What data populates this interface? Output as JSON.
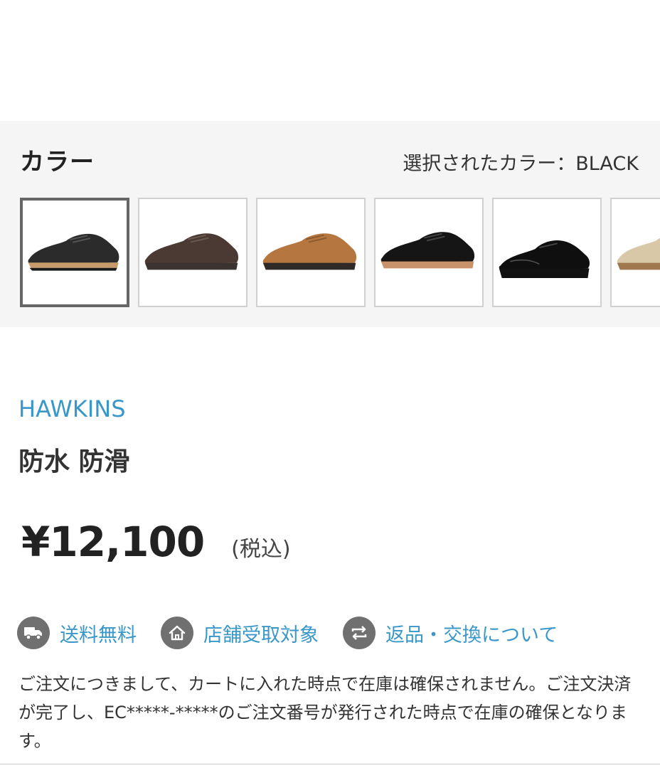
{
  "color_section": {
    "heading": "カラー",
    "selected_label": "選択されたカラー：BLACK",
    "swatches": [
      {
        "name": "black-plain-toe",
        "upper": "#2b2b2b",
        "sole": "#c89a6a",
        "selected": true
      },
      {
        "name": "dark-brown-plain-toe",
        "upper": "#4a3a33",
        "sole": "#3a3330",
        "selected": false
      },
      {
        "name": "camel-plain-toe",
        "upper": "#b5773f",
        "sole": "#2f2a27",
        "selected": false
      },
      {
        "name": "black-suede-plain-toe",
        "upper": "#151515",
        "sole": "#c8926a",
        "selected": false
      },
      {
        "name": "black-leather-business",
        "upper": "#0f0f0f",
        "sole": "#111111",
        "selected": false
      },
      {
        "name": "beige-suede",
        "upper": "#d8c8a8",
        "sole": "#a07850",
        "selected": false
      }
    ]
  },
  "product": {
    "brand": "HAWKINS",
    "name": "防水 防滑",
    "price": "¥12,100",
    "tax_note": "(税込)"
  },
  "features": [
    {
      "icon": "truck-icon",
      "label": "送料無料"
    },
    {
      "icon": "store-home-icon",
      "label": "店舗受取対象"
    },
    {
      "icon": "exchange-arrows-icon",
      "label": "返品・交換について"
    }
  ],
  "notice": "ご注文につきまして、カートに入れた時点で在庫は確保されません。ご注文決済が完了し、EC*****-*****のご注文番号が発行された時点で在庫の確保となります。"
}
